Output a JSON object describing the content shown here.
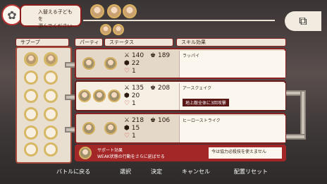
{
  "prompt": {
    "line1": "入替える子ども を",
    "line2": "選んでください"
  },
  "headers": {
    "sub": "サブープ",
    "party": "パーティ",
    "status": "ステータス",
    "skill": "スキル効果"
  },
  "rows": [
    {
      "atk": "140",
      "def": "189",
      "hp": "22",
      "lv": "1",
      "skill_name": "ラッパイ",
      "skill_desc": ""
    },
    {
      "atk": "135",
      "def": "208",
      "hp": "20",
      "lv": "1",
      "skill_name": "アースクェイク",
      "skill_desc": "地上敵全体に3回攻撃"
    },
    {
      "atk": "218",
      "def": "106",
      "hp": "15",
      "lv": "1",
      "skill_name": "ヒーローストライク",
      "skill_desc": ""
    }
  ],
  "support": {
    "title": "サポート効果",
    "desc": "WEAK状態の行動をさらに延ばせる",
    "right": "今は協力必殺技を使えません"
  },
  "bottom": {
    "back": "バトルに戻る",
    "select": "選択",
    "confirm": "決定",
    "cancel": "キャンセル",
    "reset": "配置リセット"
  },
  "icons": {
    "binoculars": "binoculars-icon"
  },
  "colors": {
    "accent": "#8a2222",
    "gold": "#d8b060"
  }
}
